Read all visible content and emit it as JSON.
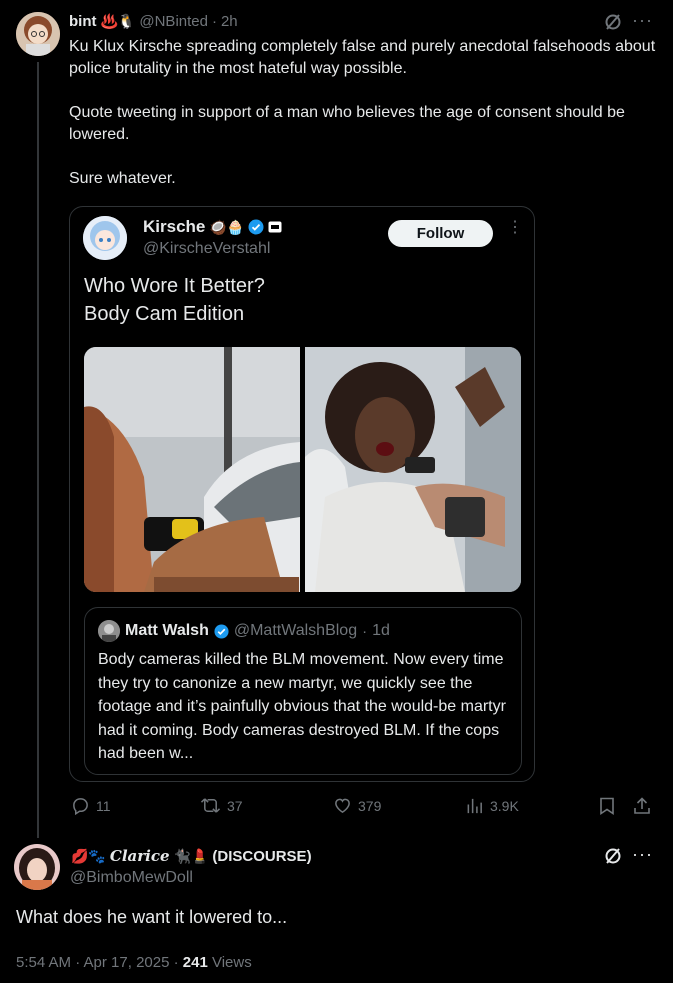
{
  "parent_tweet": {
    "display_name": "bint",
    "name_emojis": "♨️🐧",
    "handle": "@NBinted",
    "time": "2h",
    "text": "Ku Klux Kirsche spreading completely false and purely anecdotal falsehoods about police brutality in the most hateful way possible.\n\nQuote tweeting in support of a man who believes the age of consent should be lowered.\n\nSure whatever."
  },
  "quoted_tweet": {
    "display_name": "Kirsche",
    "name_emojis": "🥥🧁",
    "handle": "@KirscheVerstahl",
    "follow_label": "Follow",
    "text": "Who Wore It Better?\nBody Cam Edition",
    "nested_quote": {
      "display_name": "Matt Walsh",
      "handle": "@MattWalshBlog",
      "time": "1d",
      "text": "Body cameras killed the BLM movement. Now every time they try to canonize a new martyr, we quickly see the footage and it’s painfully obvious that the would-be martyr had it coming. Body cameras destroyed BLM. If the cops had been w..."
    }
  },
  "actions": {
    "replies": "11",
    "reposts": "37",
    "likes": "379",
    "views": "3.9K"
  },
  "reply_tweet": {
    "display_name": "𝑪𝒍𝒂𝒓𝒊𝒄𝒆",
    "display_suffix": "(DISCOURSE)",
    "handle": "@BimboMewDoll",
    "text": "What does he want it lowered to...",
    "timestamp": "5:54 AM · Apr 17, 2025 · ",
    "views_count": "241",
    "views_label": " Views"
  },
  "colors": {
    "background": "#000000",
    "text": "#e7e9ea",
    "muted": "#71767b",
    "border": "#2f3336",
    "verified": "#1d9bf0"
  }
}
